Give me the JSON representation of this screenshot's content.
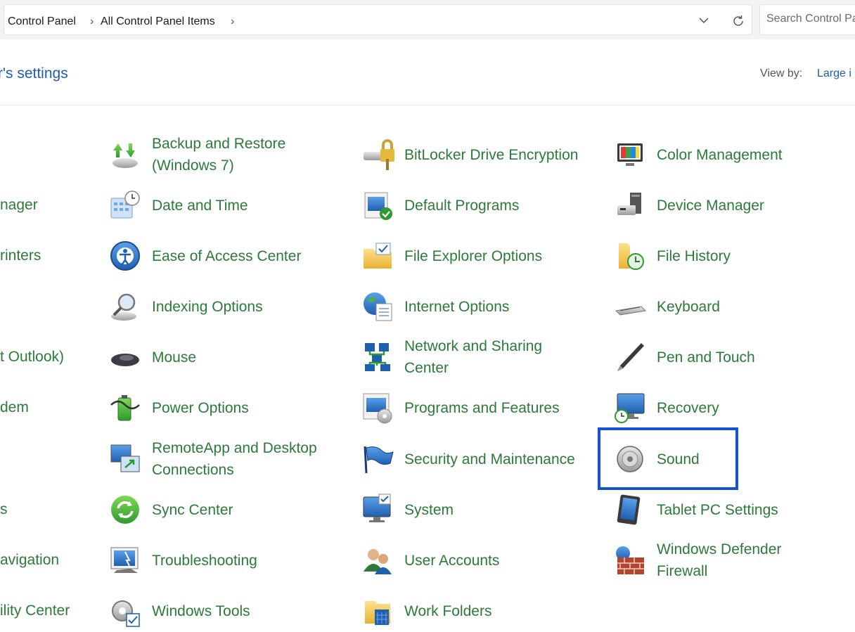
{
  "address_bar": {
    "breadcrumbs": [
      "Control Panel",
      "All Control Panel Items"
    ],
    "separator": "›"
  },
  "search": {
    "placeholder": "Search Control Panel"
  },
  "heading": "r's settings",
  "view_by": {
    "label": "View by:",
    "value": "Large i"
  },
  "left_clipped_items": [
    "nager",
    "rinters",
    "t Outlook)",
    "dem",
    "s",
    "avigation",
    "ility Center"
  ],
  "columns": [
    [
      {
        "label": "Backup and Restore\n(Windows 7)",
        "icon": "backup-restore-icon"
      },
      {
        "label": "Date and Time",
        "icon": "date-time-icon"
      },
      {
        "label": "Ease of Access Center",
        "icon": "ease-of-access-icon"
      },
      {
        "label": "Indexing Options",
        "icon": "indexing-icon"
      },
      {
        "label": "Mouse",
        "icon": "mouse-icon"
      },
      {
        "label": "Power Options",
        "icon": "power-icon"
      },
      {
        "label": "RemoteApp and Desktop\nConnections",
        "icon": "remoteapp-icon"
      },
      {
        "label": "Sync Center",
        "icon": "sync-icon"
      },
      {
        "label": "Troubleshooting",
        "icon": "troubleshooting-icon"
      },
      {
        "label": "Windows Tools",
        "icon": "windows-tools-icon"
      }
    ],
    [
      {
        "label": "BitLocker Drive Encryption",
        "icon": "bitlocker-icon"
      },
      {
        "label": "Default Programs",
        "icon": "default-programs-icon"
      },
      {
        "label": "File Explorer Options",
        "icon": "folder-options-icon"
      },
      {
        "label": "Internet Options",
        "icon": "internet-options-icon"
      },
      {
        "label": "Network and Sharing\nCenter",
        "icon": "network-icon"
      },
      {
        "label": "Programs and Features",
        "icon": "programs-icon"
      },
      {
        "label": "Security and Maintenance",
        "icon": "flag-icon"
      },
      {
        "label": "System",
        "icon": "system-icon"
      },
      {
        "label": "User Accounts",
        "icon": "user-accounts-icon"
      },
      {
        "label": "Work Folders",
        "icon": "work-folders-icon"
      }
    ],
    [
      {
        "label": "Color Management",
        "icon": "color-management-icon"
      },
      {
        "label": "Device Manager",
        "icon": "device-manager-icon"
      },
      {
        "label": "File History",
        "icon": "file-history-icon"
      },
      {
        "label": "Keyboard",
        "icon": "keyboard-icon"
      },
      {
        "label": "Pen and Touch",
        "icon": "pen-icon"
      },
      {
        "label": "Recovery",
        "icon": "recovery-icon"
      },
      {
        "label": "Sound",
        "icon": "speaker-icon",
        "highlighted": true
      },
      {
        "label": "Tablet PC Settings",
        "icon": "tablet-icon"
      },
      {
        "label": "Windows Defender\nFirewall",
        "icon": "firewall-icon"
      },
      {
        "label": "",
        "icon": ""
      }
    ]
  ],
  "colors": {
    "link_green": "#2c7a3a",
    "heading_blue": "#1e5bb8",
    "highlight_border": "#1452d6"
  }
}
